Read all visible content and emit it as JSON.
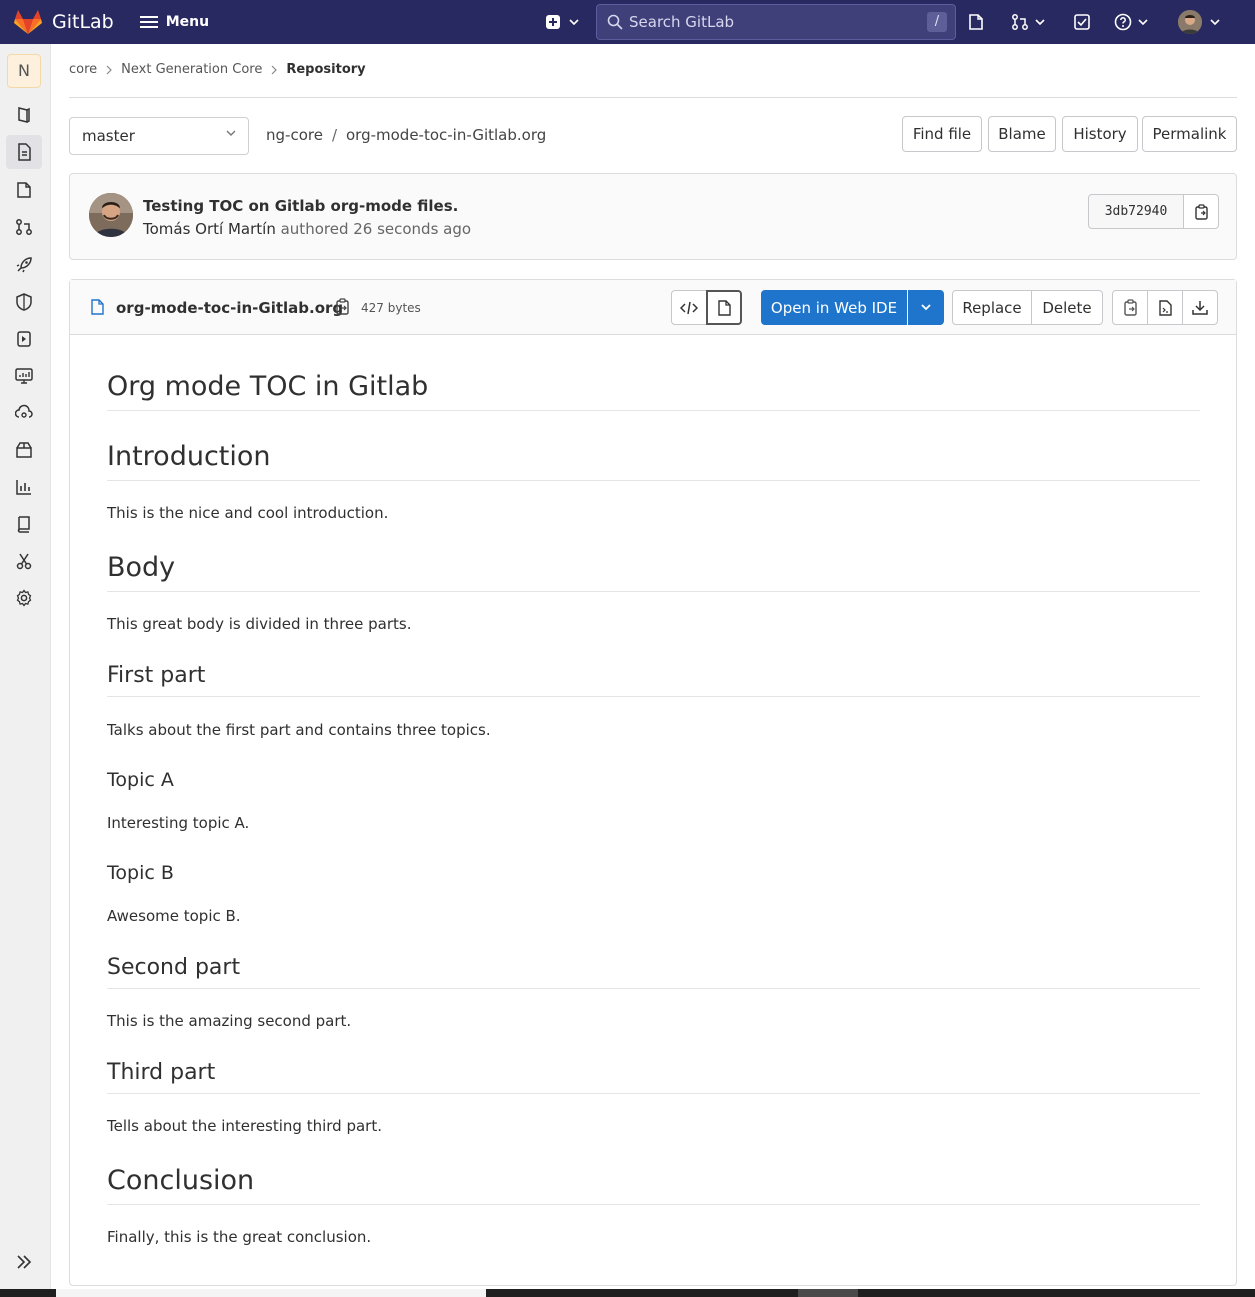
{
  "topbar": {
    "brand": "GitLab",
    "menu_label": "Menu",
    "search_placeholder": "Search GitLab",
    "search_shortcut": "/"
  },
  "sidebar": {
    "project_initial": "N"
  },
  "breadcrumb": {
    "items": [
      "core",
      "Next Generation Core",
      "Repository"
    ]
  },
  "file_nav": {
    "branch": "master",
    "path_root": "ng-core",
    "path_sep": "/",
    "file": "org-mode-toc-in-Gitlab.org",
    "find_file": "Find file",
    "blame": "Blame",
    "history": "History",
    "permalink": "Permalink"
  },
  "commit": {
    "title": "Testing TOC on Gitlab org-mode files.",
    "author": "Tomás Ortí Martín",
    "authored": "authored 26 seconds ago",
    "sha": "3db72940"
  },
  "file_header": {
    "name": "org-mode-toc-in-Gitlab.org",
    "size": "427 bytes",
    "open_web_ide": "Open in Web IDE",
    "replace": "Replace",
    "delete": "Delete"
  },
  "document": {
    "title": "Org mode TOC in Gitlab",
    "intro_h": "Introduction",
    "intro_p": "This is the nice and cool introduction.",
    "body_h": "Body",
    "body_p": "This great body is divided in three parts.",
    "first_h": "First part",
    "first_p": "Talks about the first part and contains three topics.",
    "topic_a_h": "Topic A",
    "topic_a_p": "Interesting topic A.",
    "topic_b_h": "Topic B",
    "topic_b_p": "Awesome topic B.",
    "second_h": "Second part",
    "second_p": "This is the amazing second part.",
    "third_h": "Third part",
    "third_p": "Tells about the interesting third part.",
    "conclusion_h": "Conclusion",
    "conclusion_p": "Finally, this is the great conclusion."
  },
  "colors": {
    "navbar": "#292961",
    "primary_button": "#1f75cb"
  }
}
